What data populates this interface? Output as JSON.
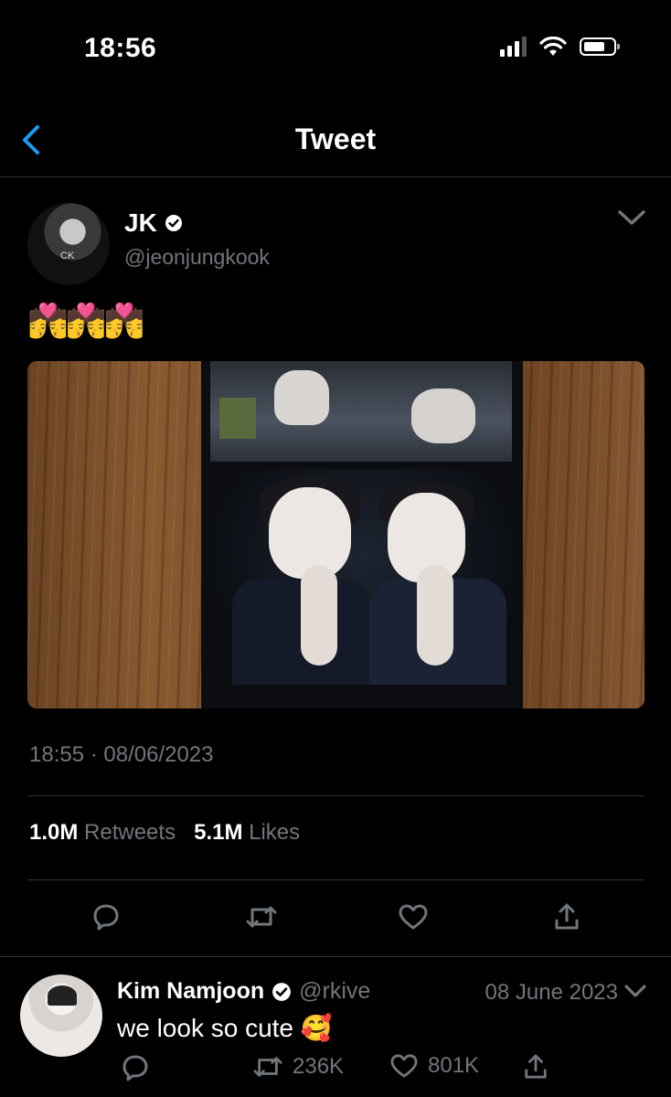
{
  "status_bar": {
    "time": "18:56",
    "icons": [
      "signal-icon",
      "wifi-icon",
      "battery-icon"
    ]
  },
  "header": {
    "title": "Tweet",
    "back_icon": "chevron-left-icon",
    "accent_color": "#1d9bf0"
  },
  "tweet": {
    "author_name": "JK",
    "author_handle": "@jeonjungkook",
    "verified": true,
    "text": "💏💏💏",
    "timestamp": "18:55 · 08/06/2023",
    "retweets_count": "1.0M",
    "retweets_label": "Retweets",
    "likes_count": "5.1M",
    "likes_label": "Likes",
    "actions": [
      "reply-icon",
      "retweet-icon",
      "like-icon",
      "share-icon"
    ]
  },
  "reply": {
    "author_name": "Kim Namjoon",
    "author_handle": "@rkive",
    "verified": true,
    "date": "08 June 2023",
    "text": "we look so cute 🥰",
    "retweets_count": "236K",
    "likes_count": "801K"
  },
  "colors": {
    "background": "#000000",
    "secondary_text": "#71767b",
    "divider": "#2f3336"
  }
}
